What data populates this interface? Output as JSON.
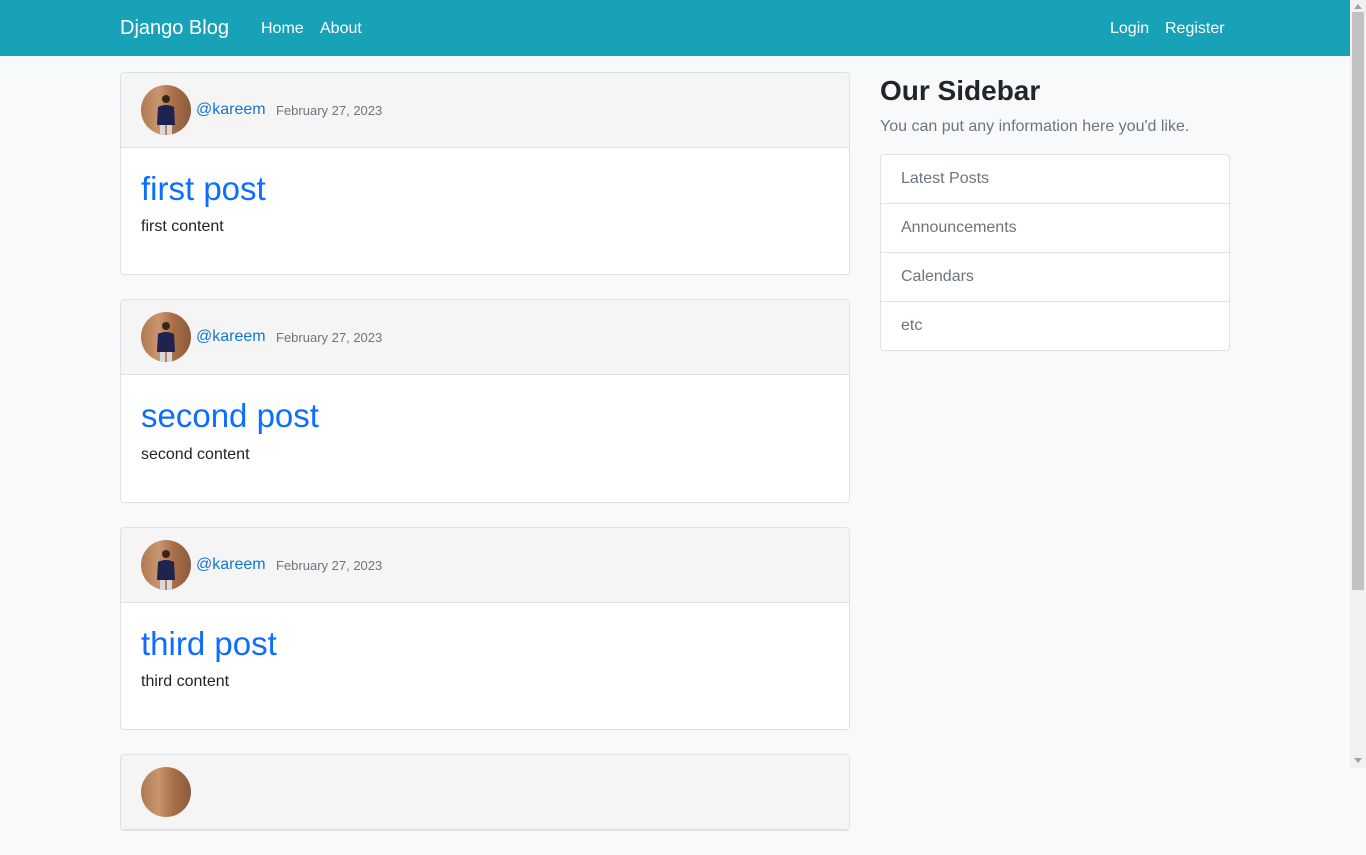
{
  "navbar": {
    "brand": "Django Blog",
    "links": [
      "Home",
      "About"
    ],
    "auth": [
      "Login",
      "Register"
    ],
    "color": "#17a2b8"
  },
  "posts": [
    {
      "author": "@kareem",
      "date": "February 27, 2023",
      "title": "first post",
      "content": "first content"
    },
    {
      "author": "@kareem",
      "date": "February 27, 2023",
      "title": "second post",
      "content": "second content"
    },
    {
      "author": "@kareem",
      "date": "February 27, 2023",
      "title": "third post",
      "content": "third content"
    }
  ],
  "sidebar": {
    "title": "Our Sidebar",
    "text": "You can put any information here you'd like.",
    "items": [
      "Latest Posts",
      "Announcements",
      "Calendars",
      "etc"
    ]
  }
}
